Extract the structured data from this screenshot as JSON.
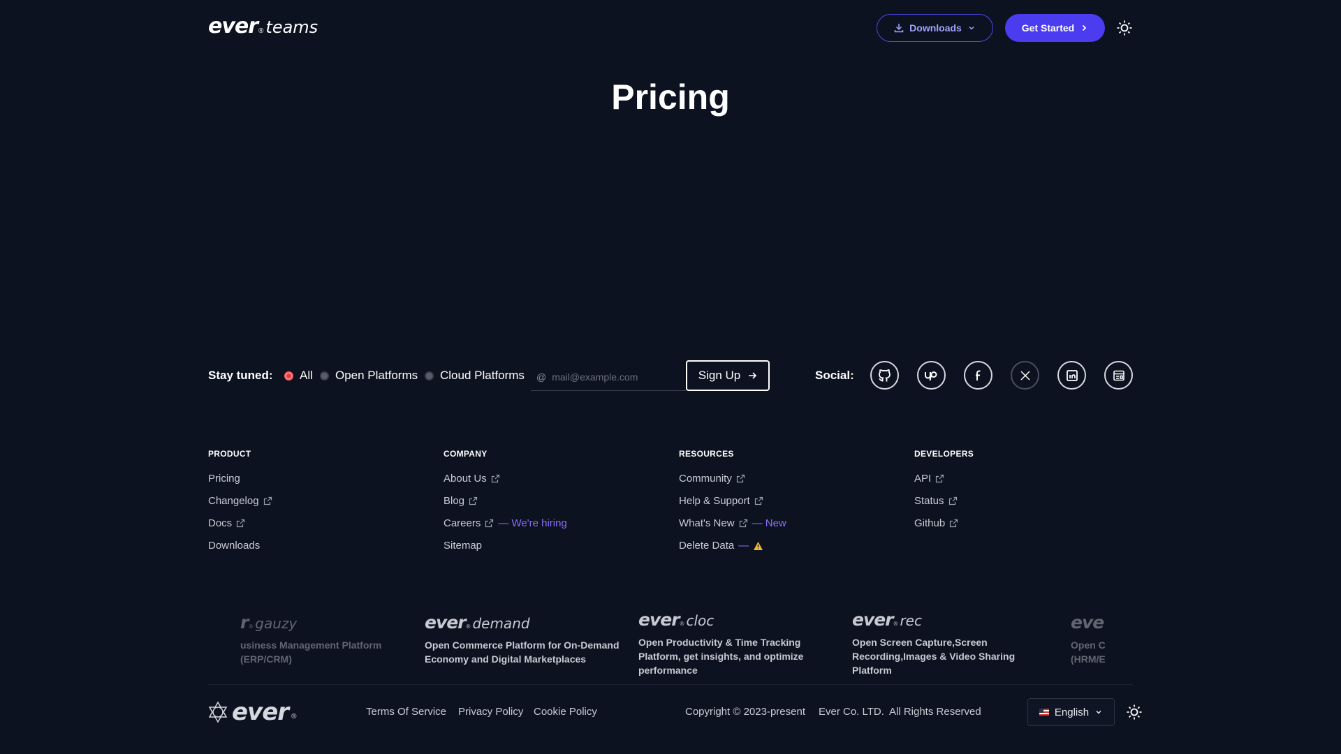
{
  "header": {
    "logo_main": "ever",
    "logo_reg": "®",
    "logo_sub": "teams",
    "downloads_label": "Downloads",
    "get_started_label": "Get Started",
    "theme_icon": "sun-icon"
  },
  "page": {
    "title": "Pricing"
  },
  "newsletter": {
    "label": "Stay tuned:",
    "options": [
      {
        "label": "All",
        "selected": true
      },
      {
        "label": "Open Platforms",
        "selected": false
      },
      {
        "label": "Cloud Platforms",
        "selected": false
      }
    ],
    "at_symbol": "@",
    "email_placeholder": "mail@example.com",
    "signup_label": "Sign Up"
  },
  "social": {
    "label": "Social:",
    "icons": [
      "github-icon",
      "upwork-icon",
      "facebook-icon",
      "x-icon",
      "linkedin-icon",
      "newsletter-icon"
    ]
  },
  "footer_columns": [
    {
      "heading": "PRODUCT",
      "links": [
        {
          "label": "Pricing",
          "external": false
        },
        {
          "label": "Changelog",
          "external": true
        },
        {
          "label": "Docs",
          "external": true
        },
        {
          "label": "Downloads",
          "external": false
        }
      ]
    },
    {
      "heading": "COMPANY",
      "links": [
        {
          "label": "About Us",
          "external": true
        },
        {
          "label": "Blog",
          "external": true
        },
        {
          "label": "Careers",
          "external": true,
          "badge": "— We're hiring"
        },
        {
          "label": "Sitemap",
          "external": false
        }
      ]
    },
    {
      "heading": "RESOURCES",
      "links": [
        {
          "label": "Community",
          "external": true
        },
        {
          "label": "Help & Support",
          "external": true
        },
        {
          "label": "What's New",
          "external": true,
          "badge": "— New"
        },
        {
          "label": "Delete Data",
          "external": false,
          "badge": "—",
          "warning": true
        }
      ]
    },
    {
      "heading": "DEVELOPERS",
      "links": [
        {
          "label": "API",
          "external": true
        },
        {
          "label": "Status",
          "external": true
        },
        {
          "label": "Github",
          "external": true
        }
      ]
    }
  ],
  "products": [
    {
      "prefix": "r",
      "name": "gauzy",
      "desc": "usiness Management Platform (ERP/CRM)"
    },
    {
      "prefix": "ever",
      "name": "demand",
      "desc": "Open Commerce Platform for On-Demand Economy and Digital Marketplaces"
    },
    {
      "prefix": "ever",
      "name": "cloc",
      "desc": "Open Productivity & Time Tracking Platform, get insights, and optimize performance"
    },
    {
      "prefix": "ever",
      "name": "rec",
      "desc": "Open Screen Capture,Screen Recording,Images & Video Sharing Platform"
    },
    {
      "prefix": "eve",
      "name": "",
      "desc": "Open C (HRM/E"
    }
  ],
  "bottom": {
    "logo": "ever",
    "logo_reg": "®",
    "terms": "Terms Of Service",
    "privacy": "Privacy Policy",
    "cookie": "Cookie Policy",
    "copyright": "Copyright © 2023-present",
    "company": "Ever Co. LTD.",
    "rights": "All Rights Reserved",
    "language": "English"
  },
  "colors": {
    "background": "#0d1220",
    "accent": "#4b3cf0",
    "badge_accent": "#8a6dff",
    "warning": "#f5b82e"
  }
}
